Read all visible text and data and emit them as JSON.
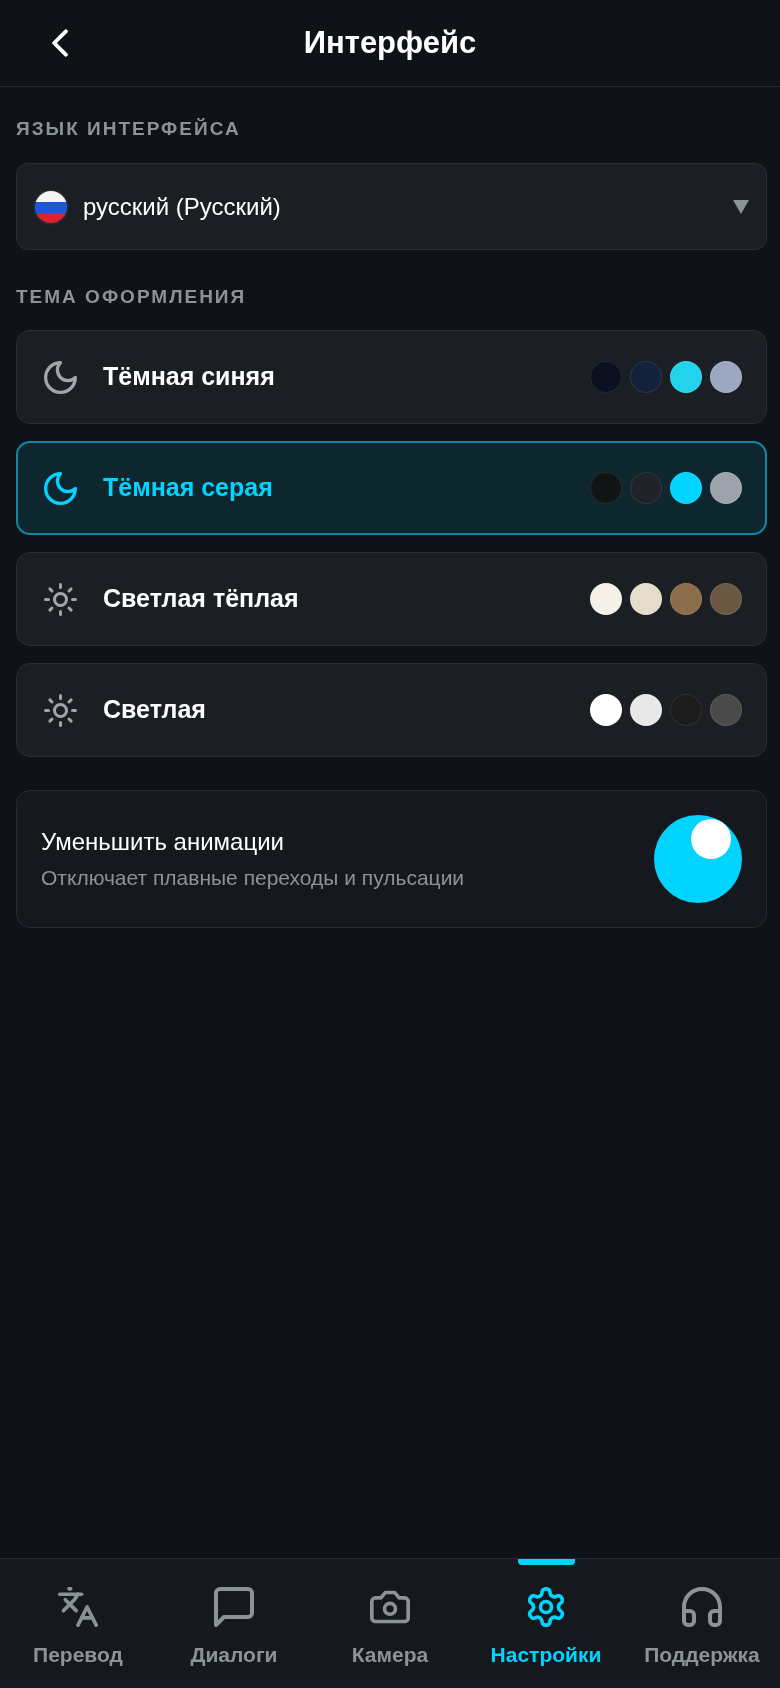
{
  "header": {
    "title": "Интерфейс"
  },
  "language_section": {
    "label": "ЯЗЫК ИНТЕРФЕЙСА",
    "select": {
      "value": "русский (Русский)"
    }
  },
  "theme_section": {
    "label": "ТЕМА ОФОРМЛЕНИЯ",
    "themes": [
      {
        "name": "Тёмная синяя",
        "kind": "dark",
        "selected": false,
        "swatches": [
          {
            "color": "#0b1120"
          },
          {
            "color": "#13213b"
          },
          {
            "color": "#22d3ee"
          },
          {
            "color": "#9ca8c0"
          }
        ]
      },
      {
        "name": "Тёмная серая",
        "kind": "dark",
        "selected": true,
        "swatches": [
          {
            "color": "#111315"
          },
          {
            "color": "#1f2226"
          },
          {
            "color": "#00d4ff"
          },
          {
            "color": "#9ca3ab"
          }
        ]
      },
      {
        "name": "Светлая тёплая",
        "kind": "light",
        "selected": false,
        "swatches": [
          {
            "color": "#f5f0e8"
          },
          {
            "color": "#e6dccb"
          },
          {
            "color": "#8b6d4a"
          },
          {
            "color": "#6b5844"
          }
        ]
      },
      {
        "name": "Светлая",
        "kind": "light",
        "selected": false,
        "swatches": [
          {
            "color": "#ffffff"
          },
          {
            "color": "#e8e8e8"
          },
          {
            "color": "#1c1c1c"
          },
          {
            "color": "#4a4a4a"
          }
        ]
      }
    ]
  },
  "reduce_motion": {
    "title": "Уменьшить анимации",
    "description": "Отключает плавные переходы и пульсации",
    "on": true
  },
  "bottom_nav": [
    {
      "label": "Перевод",
      "selected": false
    },
    {
      "label": "Диалоги",
      "selected": false
    },
    {
      "label": "Камера",
      "selected": false
    },
    {
      "label": "Настройки",
      "selected": true
    },
    {
      "label": "Поддержка",
      "selected": false
    }
  ]
}
